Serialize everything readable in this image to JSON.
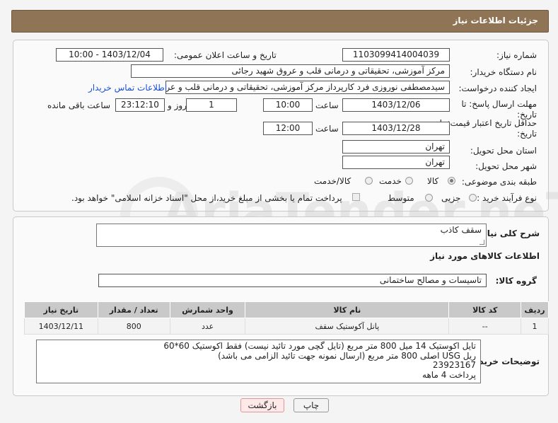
{
  "header": {
    "title": "جزئیات اطلاعات نیاز"
  },
  "form": {
    "need_number_label": "شماره نیاز:",
    "need_number": "1103099414004039",
    "announce_label": "تاریخ و ساعت اعلان عمومی:",
    "announce_value": "1403/12/04 - 10:00",
    "buyer_org_label": "نام دستگاه خریدار:",
    "buyer_org": "مرکز آموزشی، تحقیقاتی و درمانی قلب و عروق شهید رجائی",
    "creator_label": "ایجاد کننده درخواست:",
    "creator": "سیدمصطفی نوروزی فرد کارپرداز مرکز آموزشی، تحقیقاتی و درمانی قلب و عروق",
    "contact_link": "اطلاعات تماس خریدار",
    "reply_deadline_label": "مهلت ارسال پاسخ: تا تاریخ:",
    "reply_date": "1403/12/06",
    "time_label": "ساعت",
    "reply_time": "10:00",
    "days_value": "1",
    "days_label": "روز و",
    "remaining_time": "23:12:10",
    "remaining_label": "ساعت باقی مانده",
    "price_validity_label": "حداقل تاریخ اعتبار قیمت: تا تاریخ:",
    "validity_date": "1403/12/28",
    "validity_time": "12:00",
    "province_label": "استان محل تحویل:",
    "province": "تهران",
    "city_label": "شهر محل تحویل:",
    "city": "تهران",
    "category_label": "طبقه بندی موضوعی:",
    "category_options": [
      "کالا",
      "خدمت",
      "کالا/خدمت"
    ],
    "purchase_type_label": "نوع فرآیند خرید :",
    "purchase_options": [
      "جزیی",
      "متوسط"
    ],
    "payment_note": "پرداخت تمام یا بخشی از مبلغ خرید،از محل \"اسناد خزانه اسلامی\" خواهد بود."
  },
  "details": {
    "summary_label": "شرح کلی نیاز:",
    "summary": "سقف کاذب",
    "goods_info_title": "اطلاعات کالاهای مورد نیاز",
    "group_label": "گروه کالا:",
    "group_value": "تاسیسات و مصالح ساختمانی",
    "table": {
      "headers": [
        "ردیف",
        "کد کالا",
        "نام کالا",
        "واحد شمارش",
        "تعداد / مقدار",
        "تاریخ نیاز"
      ],
      "rows": [
        [
          "1",
          "--",
          "پانل آکوستیک سقف",
          "عدد",
          "800",
          "1403/12/11"
        ]
      ]
    },
    "buyer_notes_label": "توضیحات خریدار:",
    "buyer_notes": [
      "تایل اکوستیک 14 میل 800 متر مربع (تایل گچی مورد تائید نیست) فقط اکوستیک 60*60",
      "ریل USG اصلی 800 متر مربع (ارسال نمونه جهت تائید الزامی می باشد)",
      "23923167",
      "پرداخت 4 ماهه"
    ]
  },
  "buttons": {
    "print": "چاپ",
    "back": "بازگشت"
  },
  "watermark": "AriaTender.neT"
}
